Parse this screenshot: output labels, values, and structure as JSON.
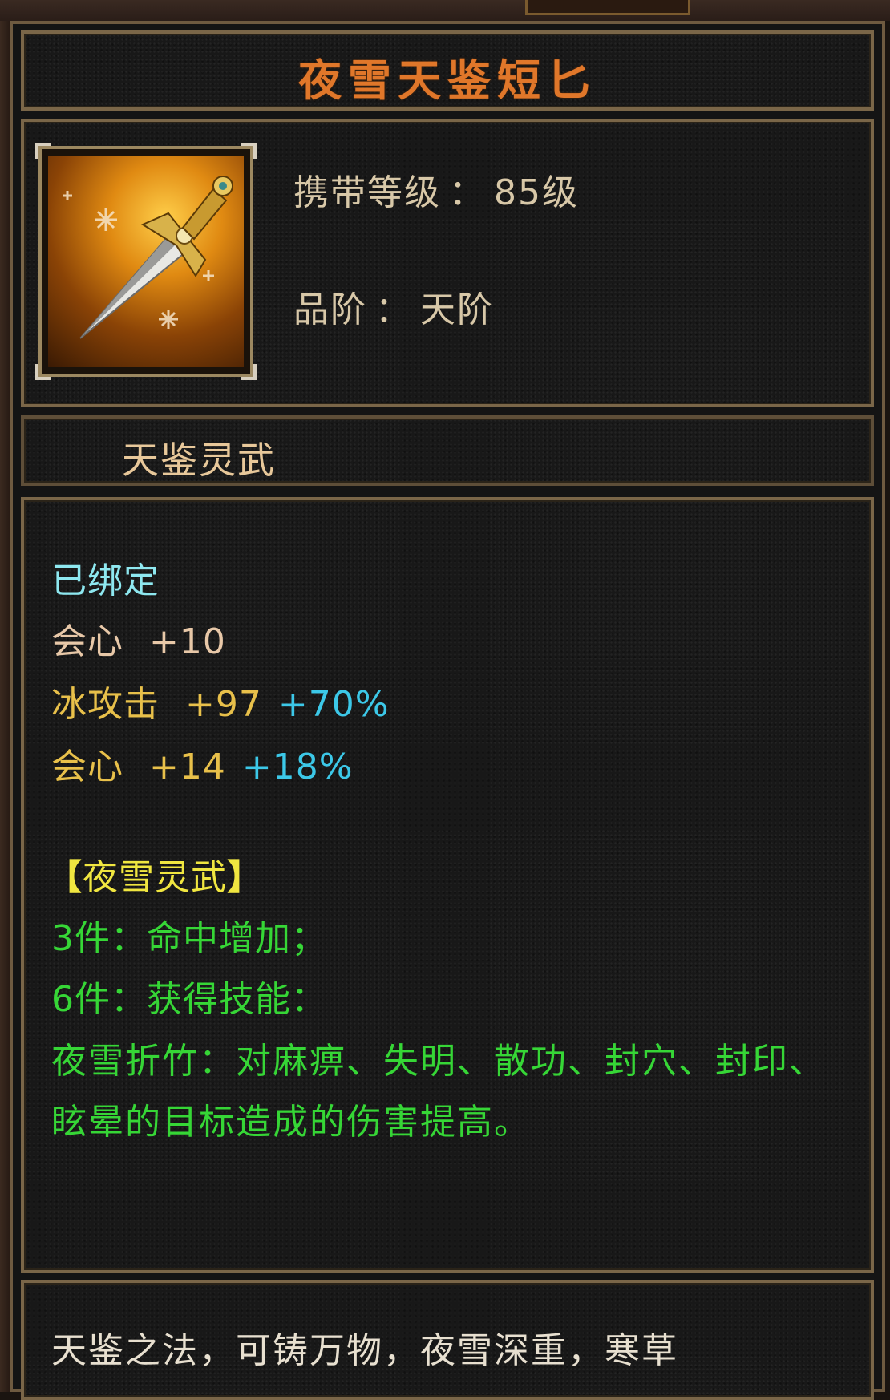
{
  "item": {
    "name": "夜雪天鉴短匕",
    "level_label": "携带等级",
    "level_value": "85级",
    "grade_label": "品阶",
    "grade_value": "天阶",
    "separator": "：",
    "category": "天鉴灵武",
    "icon": "dagger-icon"
  },
  "attributes": {
    "bound": "已绑定",
    "base": {
      "name": "会心",
      "value": "+10"
    },
    "extra": [
      {
        "name": "冰攻击",
        "value": "+97",
        "percent": "+70%"
      },
      {
        "name": "会心",
        "value": "+14",
        "percent": "+18%"
      }
    ]
  },
  "set": {
    "open_bracket": "【",
    "name": "夜雪灵武",
    "close_bracket": "】",
    "bonus3": "3件：命中增加；",
    "bonus6": "6件：获得技能：",
    "skill_text": "夜雪折竹：对麻痹、失明、散功、封穴、封印、眩晕的目标造成的伤害提高。"
  },
  "lore": "天鉴之法，可铸万物，夜雪深重，寒草",
  "colors": {
    "title": "#e0772a",
    "bound": "#8ee8f0",
    "extra": "#e8c04a",
    "percent": "#3cc8e8",
    "set": "#f0e640",
    "set_bonus": "#36d636"
  }
}
